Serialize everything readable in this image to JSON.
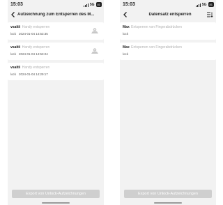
{
  "left": {
    "status": {
      "time": "15:03",
      "network": "5G",
      "battery": "81"
    },
    "title": "Aufzeichnung zum Entsperren des M...",
    "records": [
      {
        "user": "vsaitii",
        "desc": "Handy entsperren",
        "type": "lock",
        "time": "2024-01-04 14:53:35",
        "has_icon": true
      },
      {
        "user": "vsaitii",
        "desc": "Handy entsperren",
        "type": "lock",
        "time": "2024-01-04 14:53:24",
        "has_icon": true
      },
      {
        "user": "vsaitii",
        "desc": "Handy entsperren",
        "type": "lock",
        "time": "2024-01-04 14:29:17",
        "has_icon": false
      }
    ],
    "export_label": "Export von Unlock-Aufzeichnungen"
  },
  "right": {
    "status": {
      "time": "15:03",
      "network": "5G",
      "battery": "81"
    },
    "title": "Datensatz entsperren",
    "records": [
      {
        "user": "Max",
        "desc": "Entsperren von Fingerabdrücken",
        "type": "lock"
      },
      {
        "user": "Max",
        "desc": "Entsperren von Fingerabdrücken",
        "type": "lock"
      }
    ],
    "export_label": "Export von Unlock-Aufzeichnungen"
  },
  "colors": {
    "background": "#f2f2f2",
    "card": "#ffffff",
    "button_disabled": "#cfcfcf",
    "muted_text": "#b0b0b0"
  },
  "icons": {
    "back": "chevron-left-icon",
    "sort": "sort-list-icon",
    "device": "phone-location-icon"
  }
}
